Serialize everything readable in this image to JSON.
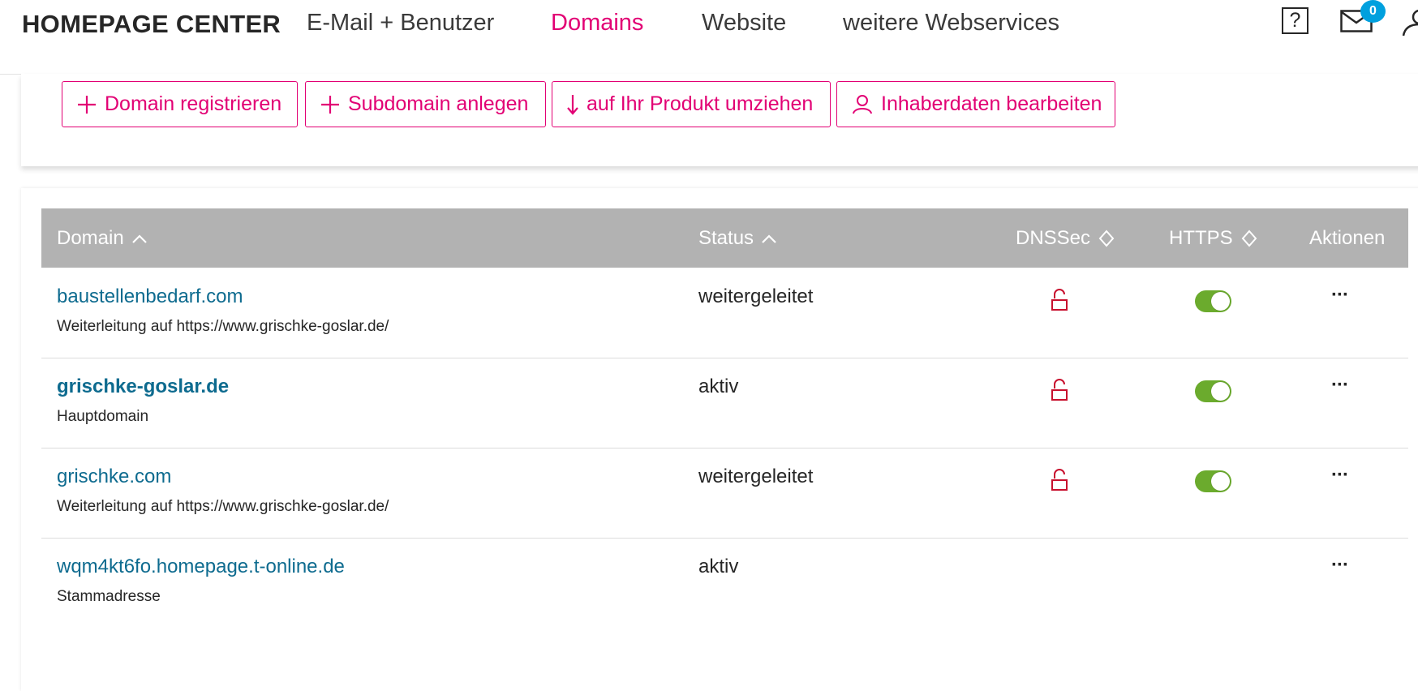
{
  "header": {
    "brand": "HOMEPAGE CENTER",
    "nav": [
      {
        "label": "E-Mail + Benutzer",
        "active": false
      },
      {
        "label": "Domains",
        "active": true
      },
      {
        "label": "Website",
        "active": false
      },
      {
        "label": "weitere Webservices",
        "active": false
      }
    ],
    "help_label": "?",
    "mail_badge": "0"
  },
  "actions": [
    {
      "label": "Domain registrieren",
      "icon": "plus-icon"
    },
    {
      "label": "Subdomain anlegen",
      "icon": "plus-icon"
    },
    {
      "label": "auf Ihr Produkt umziehen",
      "icon": "arrow-down-icon"
    },
    {
      "label": "Inhaberdaten bearbeiten",
      "icon": "user-icon"
    }
  ],
  "table": {
    "columns": {
      "domain": "Domain",
      "status": "Status",
      "dnssec": "DNSSec",
      "https": "HTTPS",
      "actions": "Aktionen"
    },
    "rows": [
      {
        "domain": "baustellenbedarf.com",
        "sub": "Weiterleitung auf https://www.grischke-goslar.de/",
        "status": "weitergeleitet",
        "dnssec": "unlocked",
        "https": true,
        "more": "···"
      },
      {
        "domain": "grischke-goslar.de",
        "sub": "Hauptdomain",
        "status": "aktiv",
        "dnssec": "unlocked",
        "https": true,
        "more": "···"
      },
      {
        "domain": "grischke.com",
        "sub": "Weiterleitung auf https://www.grischke-goslar.de/",
        "status": "weitergeleitet",
        "dnssec": "unlocked",
        "https": true,
        "more": "···"
      },
      {
        "domain": "wqm4kt6fo.homepage.t-online.de",
        "sub": "Stammadresse",
        "status": "aktiv",
        "more": "···"
      }
    ]
  },
  "colors": {
    "brand_magenta": "#e20074",
    "link_blue": "#0e6b8f",
    "table_header": "#b2b2b2",
    "toggle_on": "#6bab2d",
    "lock_red": "#c8102e",
    "badge_blue": "#00a0de"
  }
}
